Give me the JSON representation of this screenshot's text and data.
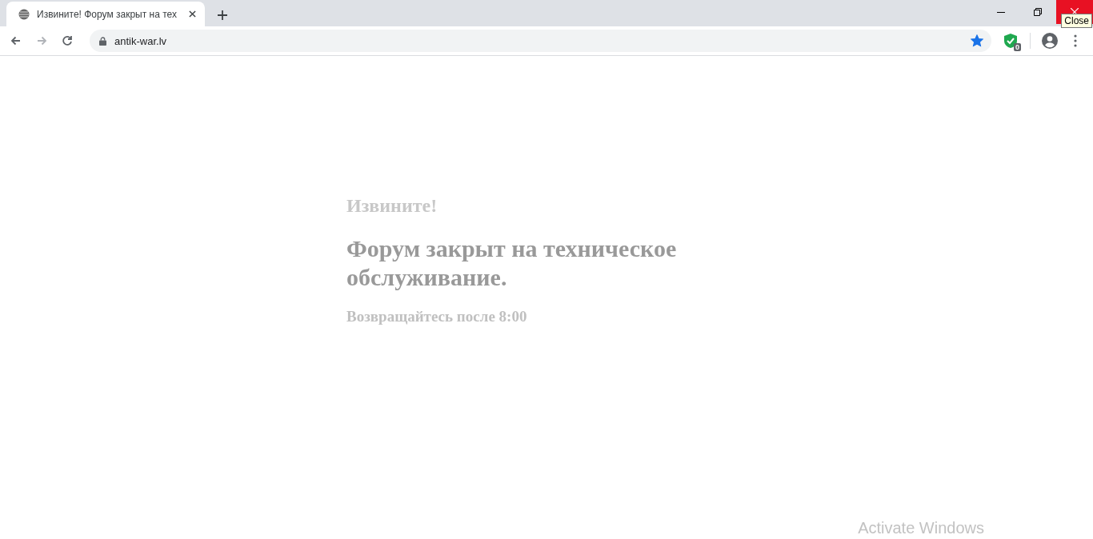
{
  "tab": {
    "title": "Извините! Форум закрыт на тех",
    "selected": true
  },
  "nav_buttons": [
    {
      "kind": "back",
      "disabled": false
    },
    {
      "kind": "forward",
      "disabled": true
    },
    {
      "kind": "reload",
      "disabled": false
    }
  ],
  "address_bar": {
    "value": "antik-war.lv",
    "secure": true,
    "bookmarked": true
  },
  "extension": {
    "badge": "0"
  },
  "tooltip": "Close",
  "page": {
    "greeting": "Извините!",
    "headline": "Форум закрыт на техническое обслуживание.",
    "note": "Возвращайтесь после 8:00"
  },
  "os_overlay": "Activate Windows"
}
